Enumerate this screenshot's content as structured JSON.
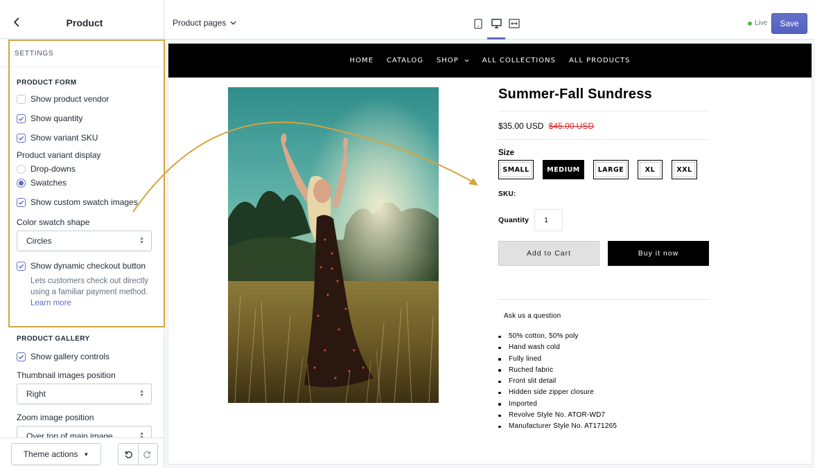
{
  "sidebar": {
    "title": "Product",
    "section_label": "SETTINGS",
    "product_form": {
      "heading": "PRODUCT FORM",
      "show_vendor": {
        "label": "Show product vendor",
        "checked": false
      },
      "show_quantity": {
        "label": "Show quantity",
        "checked": true
      },
      "show_sku": {
        "label": "Show variant SKU",
        "checked": true
      },
      "variant_display": {
        "label": "Product variant display",
        "options": [
          {
            "label": "Drop-downs",
            "selected": false
          },
          {
            "label": "Swatches",
            "selected": true
          }
        ]
      },
      "custom_swatch": {
        "label": "Show custom swatch images",
        "checked": true
      },
      "swatch_shape": {
        "label": "Color swatch shape",
        "value": "Circles"
      },
      "dynamic_checkout": {
        "label": "Show dynamic checkout button",
        "checked": true,
        "help": "Lets customers check out directly using a familiar payment method.",
        "learn_more": "Learn more"
      }
    },
    "product_gallery": {
      "heading": "PRODUCT GALLERY",
      "show_gallery_controls": {
        "label": "Show gallery controls",
        "checked": true
      },
      "thumbnail_position": {
        "label": "Thumbnail images position",
        "value": "Right"
      },
      "zoom_position": {
        "label": "Zoom image position",
        "value": "Over top of main image"
      }
    },
    "footer": {
      "theme_actions": "Theme actions"
    }
  },
  "topbar": {
    "page_select": "Product pages",
    "live_label": "Live",
    "save_label": "Save",
    "accent": "#5c6ac4"
  },
  "store": {
    "nav": [
      "HOME",
      "CATALOG",
      "SHOP",
      "ALL COLLECTIONS",
      "ALL PRODUCTS"
    ],
    "product": {
      "title": "Summer-Fall Sundress",
      "price": "$35.00 USD",
      "compare_price": "$45.00 USD",
      "size_label": "Size",
      "sizes": [
        "SMALL",
        "MEDIUM",
        "LARGE",
        "XL",
        "XXL"
      ],
      "selected_size": "MEDIUM",
      "sku_label": "SKU:",
      "quantity_label": "Quantity",
      "quantity_value": "1",
      "add_to_cart": "Add to Cart",
      "buy_now": "Buy it now",
      "ask_question": "Ask us a question",
      "features": [
        "50% cotton, 50% poly",
        "Hand wash cold",
        "Fully lined",
        "Ruched fabric",
        "Front slit detail",
        "Hidden side zipper closure",
        "Imported",
        "Revolve Style No. ATOR-WD7",
        "Manufacturer Style No. AT171265"
      ]
    }
  },
  "colors": {
    "highlight": "#d5a43d",
    "live": "#50b83c",
    "compare_price": "#e02020"
  }
}
